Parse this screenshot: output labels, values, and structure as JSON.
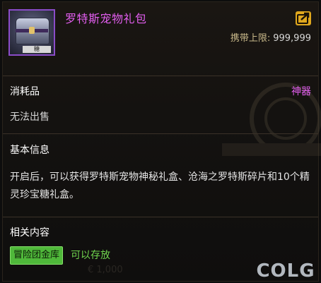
{
  "item": {
    "name": "罗特斯宠物礼包",
    "icon": "gift-chest-icon",
    "icon_tag": "糖",
    "carry_limit_label": "携带上限:",
    "carry_limit_value": "999,999"
  },
  "info": {
    "type": "消耗品",
    "grade": "神器",
    "sell_status": "无法出售"
  },
  "sections": {
    "basic_title": "基本信息",
    "description": "开启后，可以获得罗特斯宠物神秘礼盒、沧海之罗特斯碎片和10个精灵珍宝糖礼盒。",
    "related_title": "相关内容",
    "storage_badge": "冒险团金库",
    "storage_text": "可以存放"
  },
  "background": {
    "faint_text": "€ 1,000"
  },
  "watermark": {
    "text": "COLG"
  },
  "colors": {
    "title_purple": "#e35ef0",
    "green": "#6fd44e",
    "gold": "#c9b98a"
  }
}
